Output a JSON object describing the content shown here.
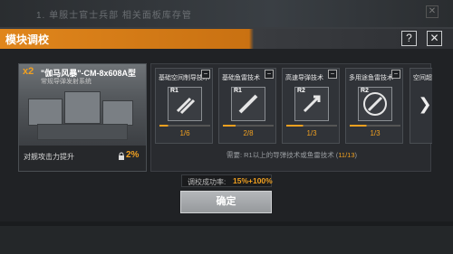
{
  "background": {
    "top_text": "1. 单服士官士兵部 相关面板库存管",
    "close_label": "✕"
  },
  "dialog": {
    "title": "模块调校",
    "help_label": "?",
    "close_label": "✕"
  },
  "module": {
    "quantity": "x2",
    "name": "\"伽马风暴\"-CM-8x608A型",
    "subtitle": "常规导弹发射系统",
    "stat_label": "对舰攻击力提升",
    "stat_value": "2%"
  },
  "techs": [
    {
      "name": "基础空间制导技术",
      "rank": "R1",
      "count": "1/6",
      "progress": 0.17
    },
    {
      "name": "基础鱼雷技术",
      "rank": "R1",
      "count": "2/8",
      "progress": 0.25
    },
    {
      "name": "高速导弹技术",
      "rank": "R2",
      "count": "1/3",
      "progress": 0.33
    },
    {
      "name": "多用途鱼雷技术",
      "rank": "R2",
      "count": "1/3",
      "progress": 0.33
    }
  ],
  "tech_partial_name": "空间超",
  "next_label": "❯",
  "requirement": {
    "prefix": "需要: R1以上的导弹技术或鱼雷技术 (",
    "count": "11/13",
    "suffix": ")"
  },
  "success_rate": {
    "label": "调校成功率:",
    "value": "15%+100%"
  },
  "confirm_label": "确定"
}
